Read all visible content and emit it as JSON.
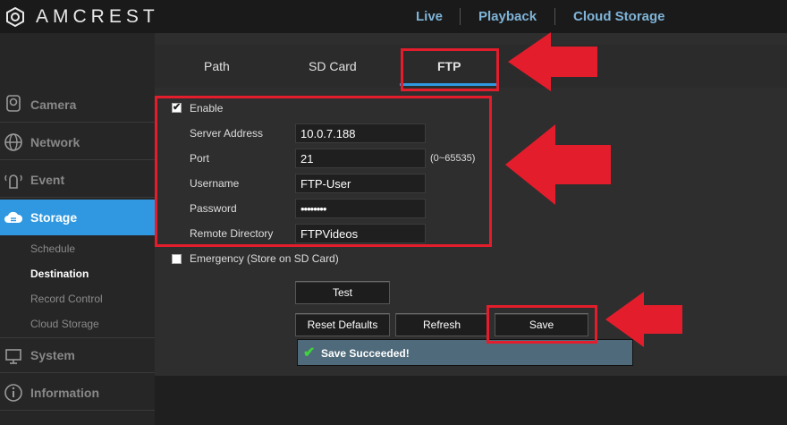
{
  "header": {
    "brand": "AMCREST",
    "nav": [
      "Live",
      "Playback",
      "Cloud Storage"
    ]
  },
  "sidebar": {
    "items": [
      {
        "label": "Camera",
        "icon": "camera-icon"
      },
      {
        "label": "Network",
        "icon": "globe-icon"
      },
      {
        "label": "Event",
        "icon": "event-icon"
      },
      {
        "label": "Storage",
        "icon": "cloud-icon"
      },
      {
        "label": "System",
        "icon": "monitor-icon"
      },
      {
        "label": "Information",
        "icon": "info-icon"
      }
    ],
    "storage_subitems": [
      "Schedule",
      "Destination",
      "Record Control",
      "Cloud Storage"
    ],
    "active_item": "Storage",
    "active_subitem": "Destination"
  },
  "tabs": [
    "Path",
    "SD Card",
    "FTP"
  ],
  "active_tab": "FTP",
  "form": {
    "enable_label": "Enable",
    "enable_checked": true,
    "server_address_label": "Server Address",
    "server_address": "10.0.7.188",
    "port_label": "Port",
    "port": "21",
    "port_range": "(0~65535)",
    "username_label": "Username",
    "username": "FTP-User",
    "password_label": "Password",
    "password": "••••••••",
    "remote_dir_label": "Remote Directory",
    "remote_dir": "FTPVideos",
    "emergency_label": "Emergency (Store on SD Card)",
    "emergency_checked": false
  },
  "buttons": {
    "test": "Test",
    "reset": "Reset Defaults",
    "refresh": "Refresh",
    "save": "Save"
  },
  "status": {
    "message": "Save Succeeded!"
  },
  "colors": {
    "accent": "#2f98e0",
    "annotation": "#e41d2c",
    "success_check": "#3fd33f"
  }
}
